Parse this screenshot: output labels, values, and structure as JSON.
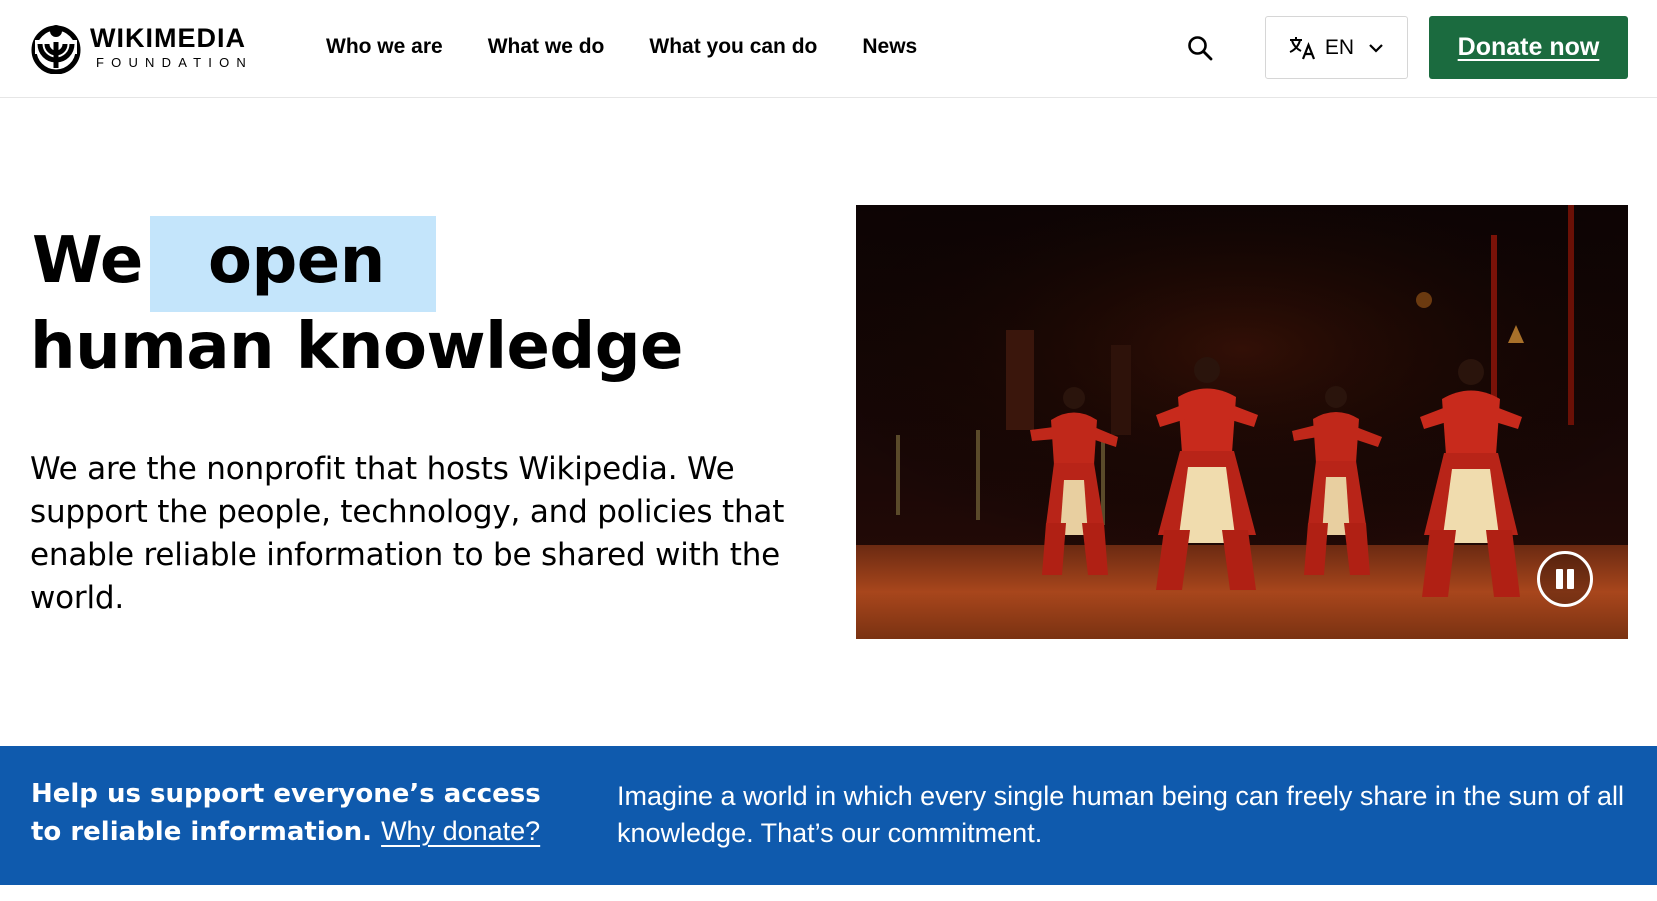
{
  "header": {
    "logo": {
      "name": "WIKIMEDIA",
      "subtitle": "FOUNDATION"
    },
    "nav": [
      {
        "label": "Who we are"
      },
      {
        "label": "What we do"
      },
      {
        "label": "What you can do"
      },
      {
        "label": "News"
      }
    ],
    "search": {
      "icon": "search-icon"
    },
    "language": {
      "icon": "translate-icon",
      "label": "EN",
      "caret_icon": "chevron-down-icon"
    },
    "donate_label": "Donate now"
  },
  "hero": {
    "title_prefix": "We",
    "title_word": "open",
    "title_line2": "human knowledge",
    "description": "We are the nonprofit that hosts Wikipedia. We support the people, technology, and policies that enable reliable information to be shared with the world.",
    "highlight_color": "#c4e5fb"
  },
  "video": {
    "pause_icon": "pause-icon"
  },
  "banner": {
    "left_bold": "Help us support everyone’s access to reliable information.",
    "left_link": "Why donate?",
    "right_text": "Imagine a world in which every single human being can freely share in the sum of all knowledge. That’s our commitment.",
    "background_color": "#0f5aad"
  },
  "colors": {
    "donate_green": "#1b6b3f",
    "text": "#000000"
  }
}
